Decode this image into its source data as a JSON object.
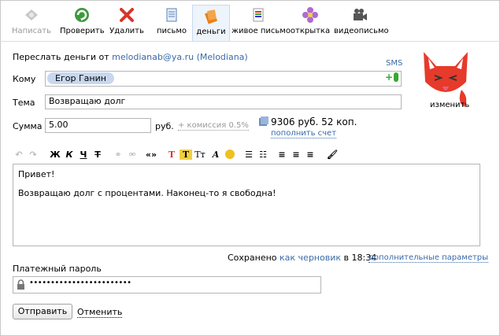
{
  "toolbar": {
    "items": [
      {
        "label": "Написать",
        "icon": "compose-icon"
      },
      {
        "label": "Проверить",
        "icon": "check-icon"
      },
      {
        "label": "Удалить",
        "icon": "delete-icon"
      },
      {
        "label": "письмо",
        "icon": "letter-icon"
      },
      {
        "label": "деньги",
        "icon": "money-icon"
      },
      {
        "label": "живое письмо",
        "icon": "live-letter-icon"
      },
      {
        "label": "открытка",
        "icon": "postcard-icon"
      },
      {
        "label": "видеописьмо",
        "icon": "video-letter-icon"
      }
    ]
  },
  "form": {
    "header_prefix": "Переслать деньги от",
    "from_address": "melodianab@ya.ru (Melodiana)",
    "sms_label": "SMS",
    "to_label": "Кому",
    "to_recipient": "Егор Ганин",
    "subject_label": "Тема",
    "subject_value": "Возвращаю долг",
    "sum_label": "Сумма",
    "sum_value": "5.00",
    "currency": "руб.",
    "commission": "+ комиссия 0.5%",
    "balance": "9306 руб. 52 коп.",
    "top_up": "пополнить счет",
    "avatar_change": "изменить"
  },
  "editor": {
    "line1": "Привет!",
    "line2": "Возвращаю долг с процентами. Наконец-то я свободна!",
    "buttons": [
      "Ж",
      "К",
      "Ч",
      "Т",
      "«»",
      "T",
      "T",
      "Tт",
      "A"
    ]
  },
  "status": {
    "saved": "Сохранено",
    "as_draft": "как черновик",
    "at": "в 18:34",
    "extra_params": "дополнительные параметры"
  },
  "password": {
    "label": "Платежный пароль",
    "value": "••••••••••••••••••••••••"
  },
  "actions": {
    "send": "Отправить",
    "cancel": "Отменить"
  }
}
